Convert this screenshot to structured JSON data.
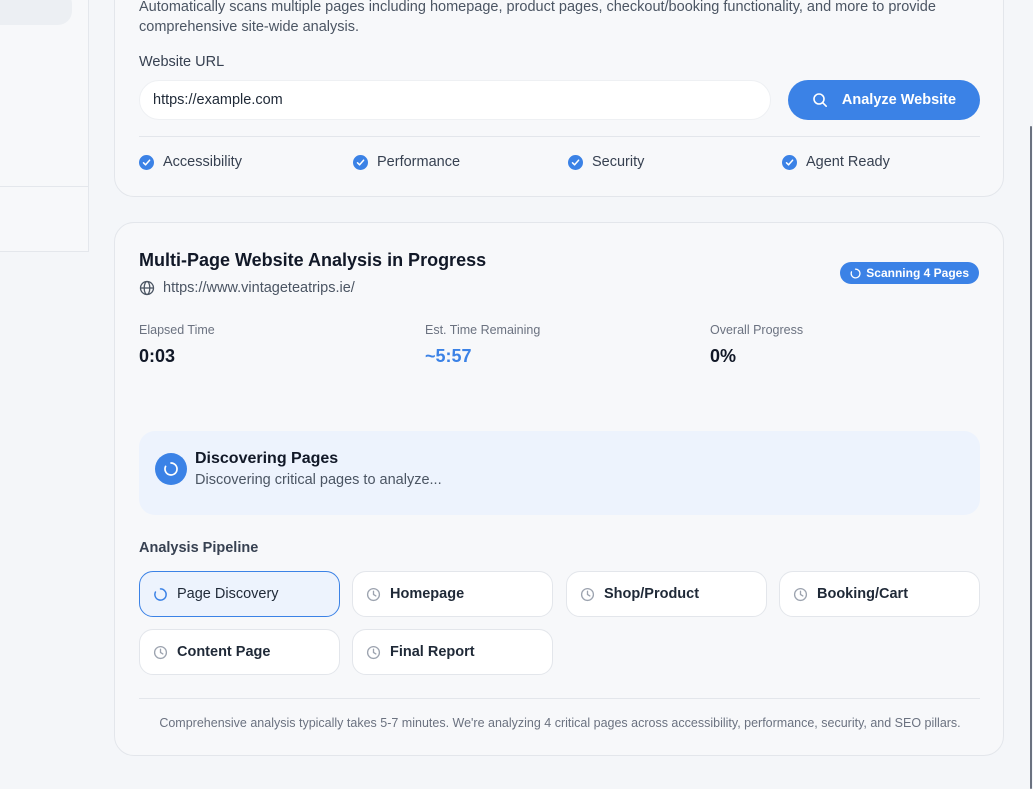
{
  "scanner": {
    "description": "Automatically scans multiple pages including homepage, product pages, checkout/booking functionality, and more to provide comprehensive site-wide analysis.",
    "url_label": "Website URL",
    "url_value": "https://example.com",
    "analyze_label": "Analyze Website",
    "checks": [
      {
        "label": "Accessibility",
        "checked": true
      },
      {
        "label": "Performance",
        "checked": true
      },
      {
        "label": "Security",
        "checked": true
      },
      {
        "label": "Agent Ready",
        "checked": true
      }
    ]
  },
  "analysis": {
    "title": "Multi-Page Website Analysis in Progress",
    "site_url": "https://www.vintageteatrips.ie/",
    "badge": "Scanning 4 Pages",
    "stats": {
      "elapsed_label": "Elapsed Time",
      "elapsed_value": "0:03",
      "remaining_label": "Est. Time Remaining",
      "remaining_value": "~5:57",
      "progress_label": "Overall Progress",
      "progress_value": "0%"
    },
    "status": {
      "title": "Discovering Pages",
      "subtitle": "Discovering critical pages to analyze..."
    },
    "pipeline_label": "Analysis Pipeline",
    "pipeline": [
      {
        "label": "Page Discovery",
        "state": "active"
      },
      {
        "label": "Homepage",
        "state": "pending"
      },
      {
        "label": "Shop/Product",
        "state": "pending"
      },
      {
        "label": "Booking/Cart",
        "state": "pending"
      },
      {
        "label": "Content Page",
        "state": "pending"
      },
      {
        "label": "Final Report",
        "state": "pending"
      }
    ],
    "footnote": "Comprehensive analysis typically takes 5-7 minutes. We're analyzing 4 critical pages across accessibility, performance, security, and SEO pillars."
  },
  "colors": {
    "accent": "#3b82e6",
    "background": "#f4f6f9",
    "status_panel": "#edf3fd"
  }
}
